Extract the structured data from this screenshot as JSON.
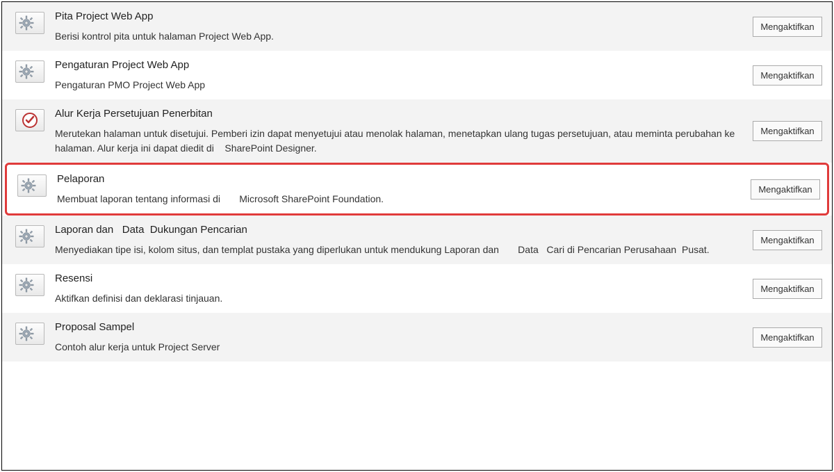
{
  "button_label": "Mengaktifkan",
  "features": [
    {
      "title": "Pita Project Web App",
      "desc": "Berisi kontrol pita untuk halaman Project Web App.",
      "icon": "gear",
      "bg": "alt",
      "highlighted": false
    },
    {
      "title": "Pengaturan Project Web App",
      "desc": "Pengaturan PMO Project Web App",
      "icon": "gear",
      "bg": "plain",
      "highlighted": false
    },
    {
      "title": "Alur Kerja Persetujuan Penerbitan",
      "desc": "Merutekan halaman untuk disetujui. Pemberi izin dapat menyetujui atau menolak halaman, menetapkan ulang tugas persetujuan, atau meminta perubahan ke halaman. Alur kerja ini dapat diedit di    SharePoint Designer.",
      "icon": "approval",
      "bg": "alt",
      "highlighted": false
    },
    {
      "title": "Pelaporan",
      "desc": "Membuat laporan tentang informasi di       Microsoft SharePoint Foundation.",
      "icon": "gear",
      "bg": "plain",
      "highlighted": true
    },
    {
      "title": "Laporan dan   Data  Dukungan Pencarian",
      "desc": "Menyediakan tipe isi, kolom situs, dan templat pustaka yang diperlukan untuk mendukung Laporan dan       Data   Cari di Pencarian Perusahaan  Pusat.",
      "icon": "gear",
      "bg": "alt",
      "highlighted": false
    },
    {
      "title": "Resensi",
      "desc": "Aktifkan definisi dan deklarasi tinjauan.",
      "icon": "gear",
      "bg": "plain",
      "highlighted": false
    },
    {
      "title": "Proposal Sampel",
      "desc": "Contoh alur kerja untuk Project Server",
      "icon": "gear",
      "bg": "alt",
      "highlighted": false
    }
  ]
}
